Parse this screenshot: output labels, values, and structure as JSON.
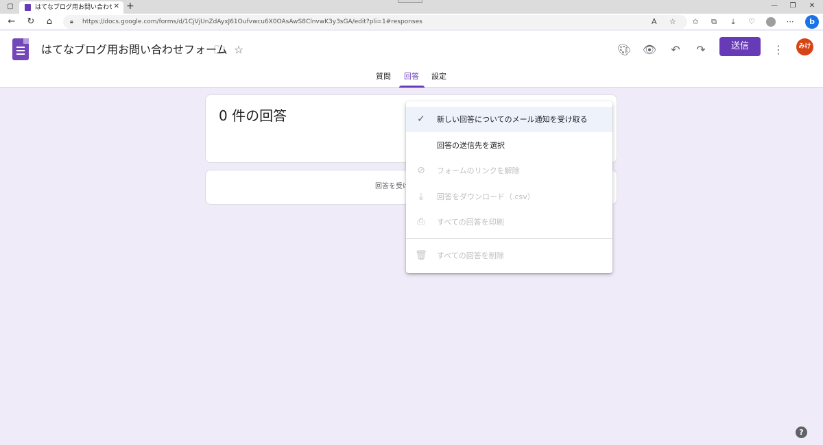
{
  "browser": {
    "tab_title": "はてなブログ用お問い合わせフォーム - ",
    "url": "https://docs.google.com/forms/d/1CjVjUnZdAyxJ61Oufvwcu6X0OAsAwS8ClnvwK3y3sGA/edit?pli=1#responses",
    "icons": {
      "tab_actions": "tab-actions-icon",
      "close": "close-icon",
      "new_tab": "plus-icon",
      "back": "back-arrow-icon",
      "refresh": "refresh-icon",
      "home": "home-icon",
      "lock": "lock-icon",
      "read_aloud": "read-aloud-icon",
      "favorite": "star-icon",
      "bing": "bing-icon"
    },
    "read_aloud_label": "A",
    "bing_label": "b"
  },
  "header": {
    "form_title": "はてなブログ用お問い合わせフォーム",
    "send_label": "送信",
    "avatar_label": "みけ"
  },
  "tabs": [
    {
      "label": "質問"
    },
    {
      "label": "回答"
    },
    {
      "label": "設定"
    }
  ],
  "active_tab": "回答",
  "summary": {
    "response_count_text": "0 件の回答"
  },
  "accepting": {
    "text": "回答を受け"
  },
  "menu": {
    "items": [
      {
        "label": "新しい回答についてのメール通知を受け取る",
        "icon": "check-icon",
        "enabled": true,
        "checked": true
      },
      {
        "label": "回答の送信先を選択",
        "icon": "",
        "enabled": true
      },
      {
        "label": "フォームのリンクを解除",
        "icon": "unlink-icon",
        "enabled": false
      },
      {
        "label": "回答をダウンロード（.csv）",
        "icon": "download-icon",
        "enabled": false
      },
      {
        "label": "すべての回答を印刷",
        "icon": "print-icon",
        "enabled": false
      },
      {
        "label": "すべての回答を削除",
        "icon": "trash-icon",
        "enabled": false
      }
    ]
  },
  "colors": {
    "brand_purple": "#673ab7",
    "page_background": "#f0ebf8",
    "avatar": "#d84315"
  }
}
